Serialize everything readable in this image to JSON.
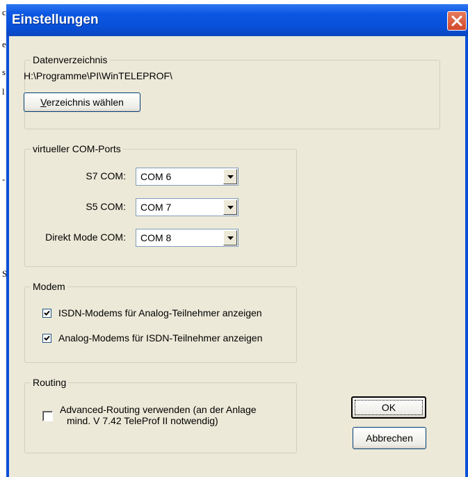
{
  "background_chars": [
    "c",
    "e",
    "s",
    "l",
    "-",
    "S"
  ],
  "window": {
    "title": "Einstellungen",
    "close_icon": "close-x-icon"
  },
  "data_dir": {
    "legend": "Datenverzeichnis",
    "path": "H:\\Programme\\PI\\WinTELEPROF\\",
    "choose_button": "Verzeichnis wählen"
  },
  "com_ports": {
    "legend": "virtueller COM-Ports",
    "rows": [
      {
        "label": "S7 COM:",
        "value": "COM 6"
      },
      {
        "label": "S5 COM:",
        "value": "COM 7"
      },
      {
        "label": "Direkt Mode COM:",
        "value": "COM 8"
      }
    ]
  },
  "modem": {
    "legend": "Modem",
    "options": [
      {
        "label": "ISDN-Modems für Analog-Teilnehmer anzeigen",
        "checked": true
      },
      {
        "label": "Analog-Modems für ISDN-Teilnehmer anzeigen",
        "checked": true
      }
    ]
  },
  "routing": {
    "legend": "Routing",
    "option_line1": "Advanced-Routing verwenden (an der Anlage",
    "option_line2": "mind. V 7.42 TeleProf II notwendig)",
    "checked": false
  },
  "buttons": {
    "ok": "OK",
    "cancel": "Abbrechen"
  },
  "colors": {
    "titlebar": "#0a55e0",
    "dialog_bg": "#ece9d8",
    "close_button": "#d9553a"
  }
}
